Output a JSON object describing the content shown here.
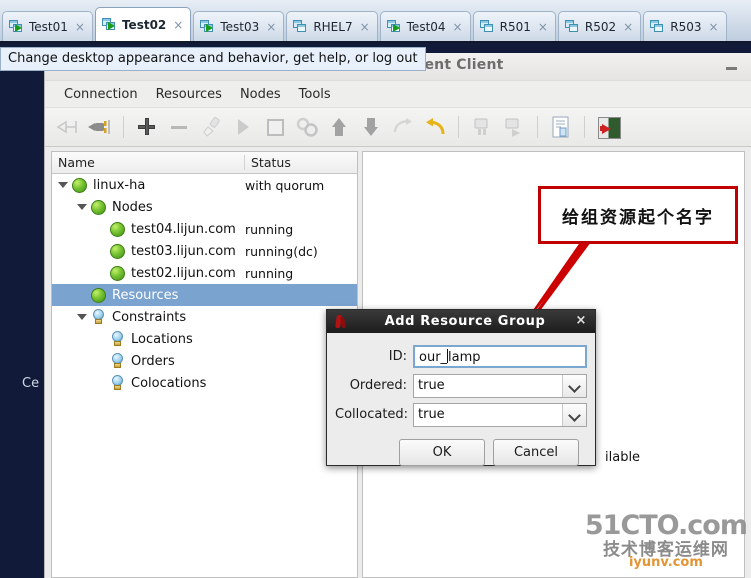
{
  "vm_tabs": [
    {
      "label": "Test01",
      "running": true,
      "active": false,
      "close": "×"
    },
    {
      "label": "Test02",
      "running": true,
      "active": true,
      "close": "×"
    },
    {
      "label": "Test03",
      "running": true,
      "active": false,
      "close": "×"
    },
    {
      "label": "RHEL7",
      "running": false,
      "active": false,
      "close": "×"
    },
    {
      "label": "Test04",
      "running": true,
      "active": false,
      "close": "×"
    },
    {
      "label": "R501",
      "running": false,
      "active": false,
      "close": "×"
    },
    {
      "label": "R502",
      "running": false,
      "active": false,
      "close": "×"
    },
    {
      "label": "R503",
      "running": false,
      "active": false,
      "close": "×"
    }
  ],
  "tooltip": {
    "text": "Change desktop appearance and behavior, get help, or log out"
  },
  "window": {
    "title_visible": "ement Client",
    "minimize_label": "–"
  },
  "menu": {
    "items": [
      "Connection",
      "Resources",
      "Nodes",
      "Tools"
    ]
  },
  "toolbar": {
    "buttons": [
      {
        "name": "connect-icon",
        "enabled": false
      },
      {
        "name": "disconnect-plug-icon",
        "enabled": true
      },
      {
        "name": "add-icon",
        "enabled": true
      },
      {
        "name": "remove-icon",
        "enabled": false
      },
      {
        "name": "cleanup-brush-icon",
        "enabled": false
      },
      {
        "name": "start-icon",
        "enabled": false
      },
      {
        "name": "stop-icon",
        "enabled": false
      },
      {
        "name": "manage-gears-icon",
        "enabled": true
      },
      {
        "name": "move-up-icon",
        "enabled": true
      },
      {
        "name": "move-down-icon",
        "enabled": true
      },
      {
        "name": "migrate-icon",
        "enabled": false
      },
      {
        "name": "undo-icon",
        "enabled": true
      },
      {
        "name": "node-standby-icon",
        "enabled": false
      },
      {
        "name": "node-online-icon",
        "enabled": false
      },
      {
        "name": "report-icon",
        "enabled": true
      },
      {
        "name": "exit-icon",
        "enabled": true
      }
    ]
  },
  "tree": {
    "columns": {
      "name": "Name",
      "status": "Status"
    },
    "rows": [
      {
        "label": "linux-ha",
        "status": "with quorum",
        "indent": 0,
        "icon": "status-ball",
        "twisty": true,
        "selected": false
      },
      {
        "label": "Nodes",
        "status": "",
        "indent": 1,
        "icon": "status-ball",
        "twisty": true,
        "selected": false
      },
      {
        "label": "test04.lijun.com",
        "status": "running",
        "indent": 2,
        "icon": "status-ball",
        "twisty": false,
        "selected": false
      },
      {
        "label": "test03.lijun.com",
        "status": "running(dc)",
        "indent": 2,
        "icon": "status-ball",
        "twisty": false,
        "selected": false
      },
      {
        "label": "test02.lijun.com",
        "status": "running",
        "indent": 2,
        "icon": "status-ball",
        "twisty": false,
        "selected": false
      },
      {
        "label": "Resources",
        "status": "",
        "indent": 1,
        "icon": "status-ball",
        "twisty": false,
        "selected": true
      },
      {
        "label": "Constraints",
        "status": "",
        "indent": 1,
        "icon": "bulb",
        "twisty": true,
        "selected": false
      },
      {
        "label": "Locations",
        "status": "",
        "indent": 2,
        "icon": "bulb",
        "twisty": false,
        "selected": false
      },
      {
        "label": "Orders",
        "status": "",
        "indent": 2,
        "icon": "bulb",
        "twisty": false,
        "selected": false
      },
      {
        "label": "Colocations",
        "status": "",
        "indent": 2,
        "icon": "bulb",
        "twisty": false,
        "selected": false
      }
    ]
  },
  "right_pane": {
    "partial_text": "ilable"
  },
  "annotation": {
    "text": "给组资源起个名字",
    "border_color": "#c00000"
  },
  "dialog": {
    "title": "Add Resource Group",
    "close_label": "×",
    "fields": [
      {
        "label": "ID:",
        "value": "our_lamp",
        "type": "text",
        "focused": true
      },
      {
        "label": "Ordered:",
        "value": "true",
        "type": "combo",
        "focused": false
      },
      {
        "label": "Collocated:",
        "value": "true",
        "type": "combo",
        "focused": false
      }
    ],
    "buttons": {
      "ok": "OK",
      "cancel": "Cancel"
    }
  },
  "desktop": {
    "partial_text": "Ce"
  },
  "watermark": {
    "line1": "51CTO.com",
    "line2": "技术博客运维网",
    "line3": "iyunv.com"
  }
}
